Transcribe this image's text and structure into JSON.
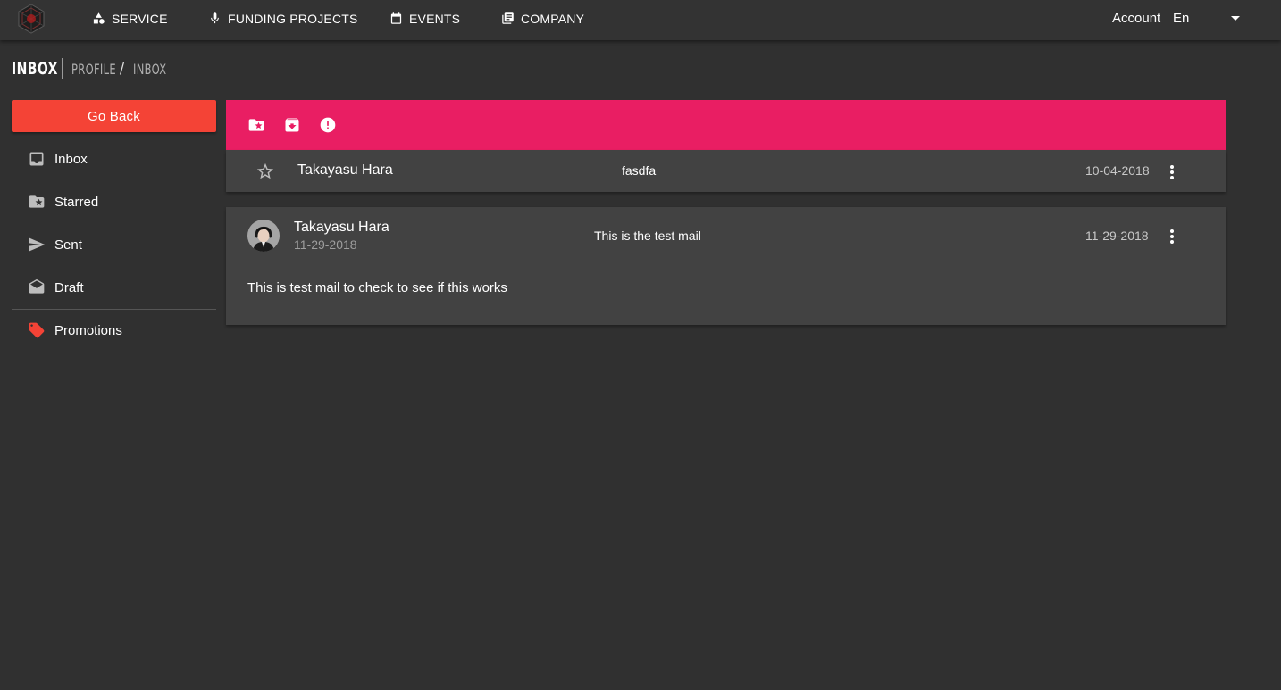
{
  "nav": {
    "logo": "company-logo",
    "items": [
      {
        "label": "SERVICE",
        "icon": "shapes-icon"
      },
      {
        "label": "FUNDING PROJECTS",
        "icon": "microphone-icon"
      },
      {
        "label": "EVENTS",
        "icon": "calendar-icon"
      },
      {
        "label": "COMPANY",
        "icon": "library-books-icon"
      }
    ],
    "account_label": "Account",
    "language": "En"
  },
  "breadcrumb": {
    "title": "INBOX",
    "path": [
      "PROFILE",
      "INBOX"
    ],
    "separator": "/"
  },
  "sidebar": {
    "go_back_label": "Go Back",
    "items": [
      {
        "label": "Inbox",
        "icon": "inbox-icon"
      },
      {
        "label": "Starred",
        "icon": "starred-folder-icon"
      },
      {
        "label": "Sent",
        "icon": "send-icon"
      },
      {
        "label": "Draft",
        "icon": "drafts-icon"
      }
    ],
    "labels": [
      {
        "label": "Promotions",
        "icon": "tag-icon",
        "color": "#f44336"
      }
    ]
  },
  "toolbar": {
    "accent_color": "#e91e63",
    "actions": [
      "starred-folder-icon",
      "archive-icon",
      "report-icon"
    ]
  },
  "mails": {
    "row": {
      "sender": "Takayasu Hara",
      "subject": "fasdfa",
      "date": "10-04-2018",
      "starred": false
    },
    "expanded": {
      "sender": "Takayasu Hara",
      "sent_date": "11-29-2018",
      "subject": "This is the test mail",
      "date": "11-29-2018",
      "body": "This is test mail to check to see if this works"
    }
  },
  "colors": {
    "background": "#303030",
    "surface": "#424242",
    "go_back": "#f44336"
  }
}
